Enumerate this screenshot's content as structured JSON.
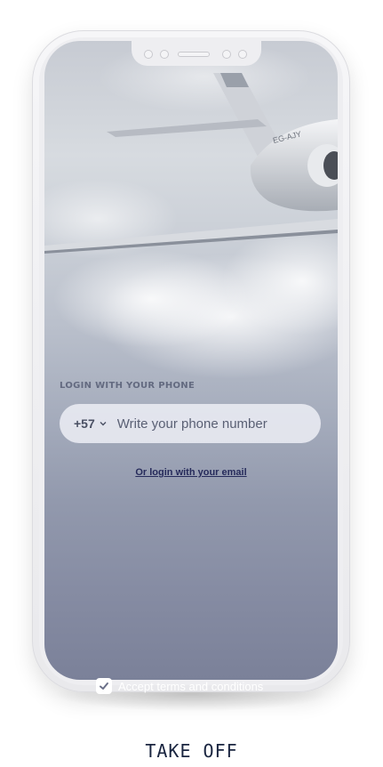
{
  "login": {
    "title": "LOGIN WITH YOUR PHONE",
    "country_code": "+57",
    "phone_placeholder": "Write your phone number",
    "email_link": "Or login with your email"
  },
  "terms": {
    "label": "Accept terms and conditions",
    "checked": true
  },
  "brand": {
    "name": "TAKE OFF"
  },
  "background": {
    "image": "private jet flying through clouds",
    "aircraft_registration": "EG-AJY"
  },
  "colors": {
    "link": "#262b5b",
    "brand_text": "#1a2540",
    "screen_bottom": "#7b8199"
  }
}
